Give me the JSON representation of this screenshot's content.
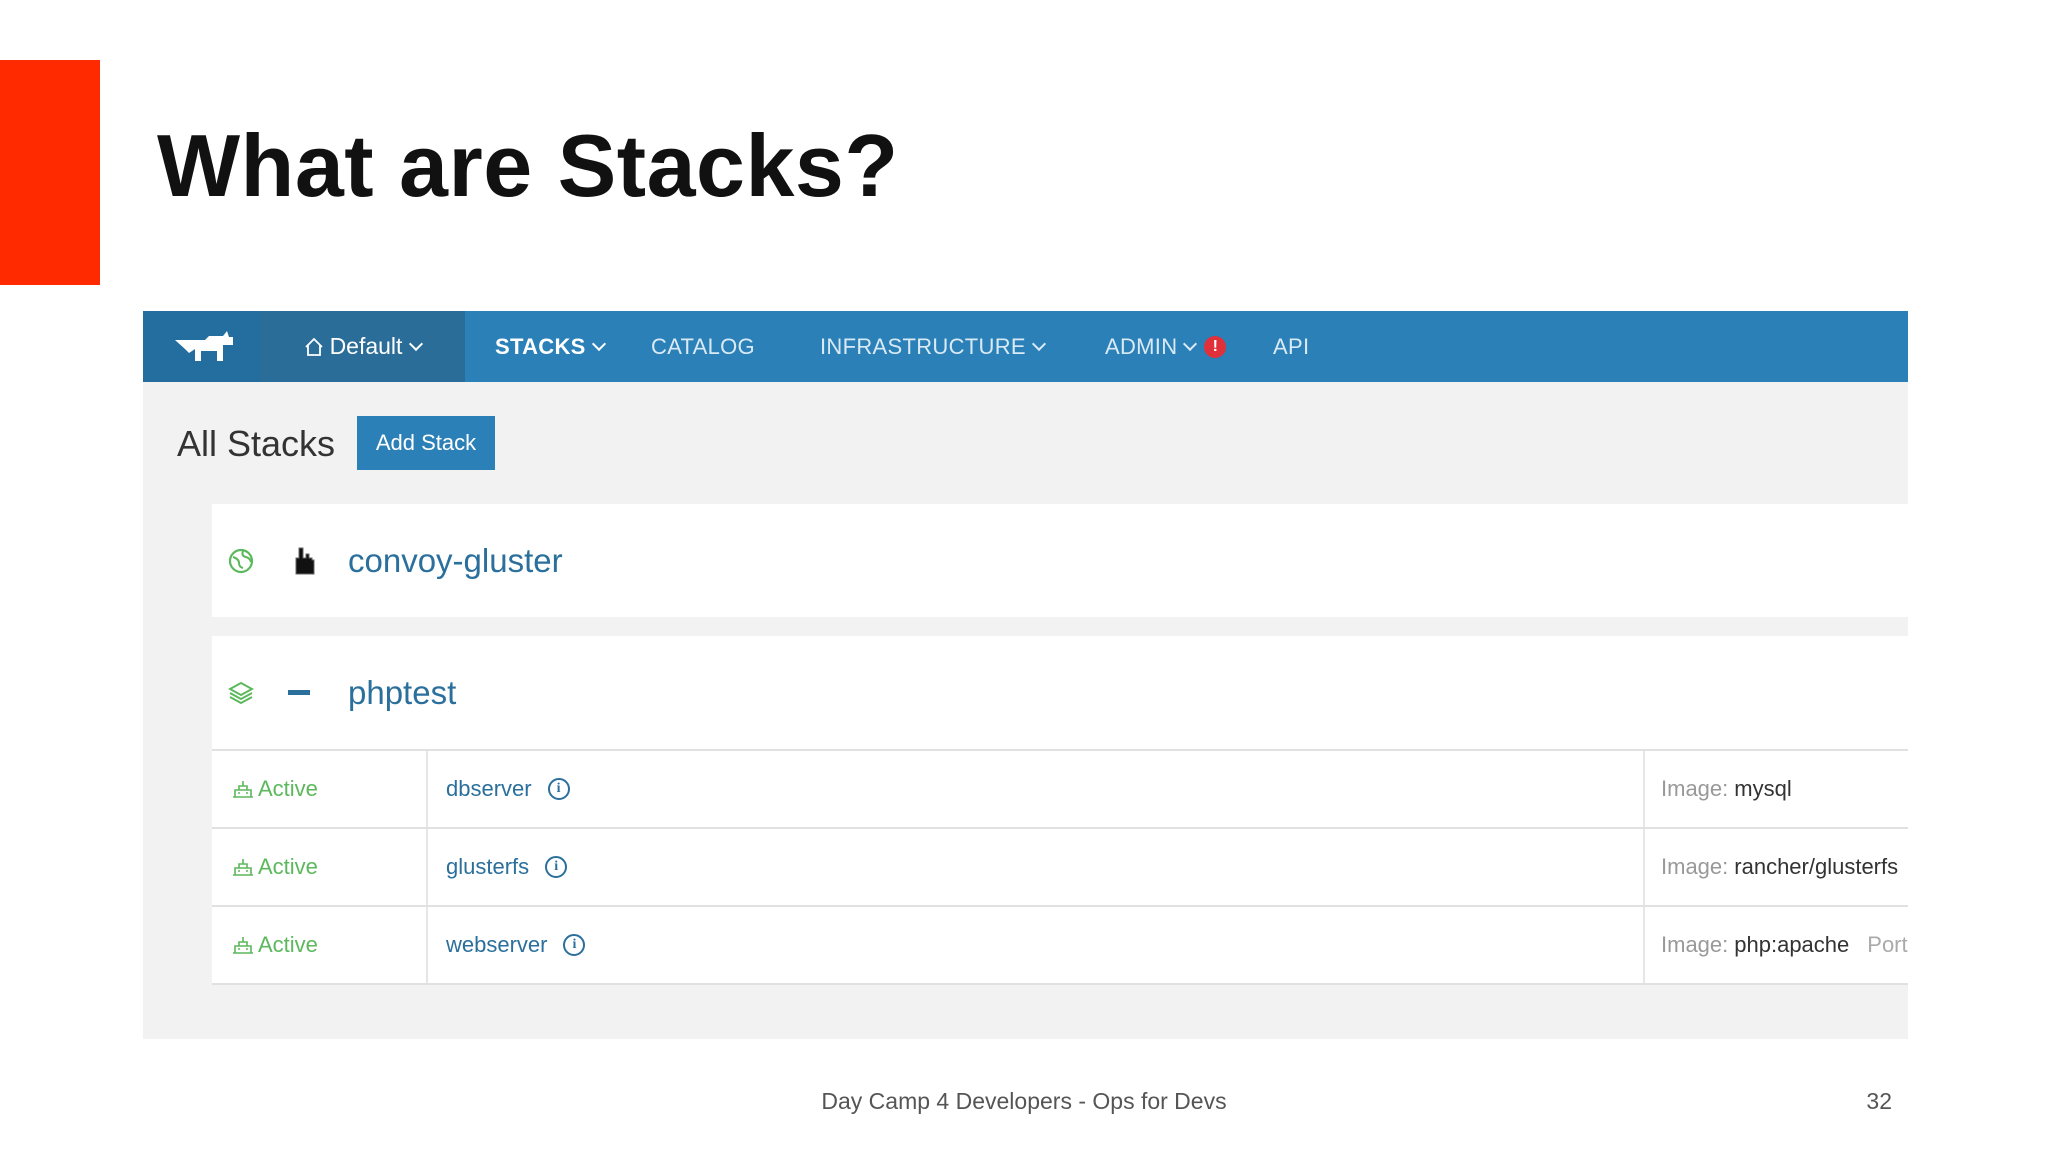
{
  "slide": {
    "title": "What are Stacks?",
    "footer": "Day Camp 4 Developers - Ops for Devs",
    "page_number": "32",
    "accent_color": "#ff2a00"
  },
  "nav": {
    "environment": "Default",
    "items": [
      {
        "label": "STACKS",
        "active": true,
        "dropdown": true
      },
      {
        "label": "CATALOG",
        "active": false,
        "dropdown": false
      },
      {
        "label": "INFRASTRUCTURE",
        "active": false,
        "dropdown": true
      },
      {
        "label": "ADMIN",
        "active": false,
        "dropdown": true,
        "alert": "!"
      },
      {
        "label": "API",
        "active": false,
        "dropdown": false
      }
    ],
    "color": "#2b80b8"
  },
  "page": {
    "heading": "All Stacks",
    "add_button": "Add Stack"
  },
  "stacks": [
    {
      "name": "convoy-gluster",
      "state_icon": "globe-icon",
      "toggle_icon": "cursor-hand-icon"
    },
    {
      "name": "phptest",
      "state_icon": "layers-icon",
      "toggle_icon": "collapse-minus-icon",
      "services": [
        {
          "state": "Active",
          "name": "dbserver",
          "image_label": "Image:",
          "image": "mysql",
          "extra": ""
        },
        {
          "state": "Active",
          "name": "glusterfs",
          "image_label": "Image:",
          "image": "rancher/glusterfs",
          "extra": ""
        },
        {
          "state": "Active",
          "name": "webserver",
          "image_label": "Image:",
          "image": "php:apache",
          "extra": "Port"
        }
      ]
    }
  ]
}
